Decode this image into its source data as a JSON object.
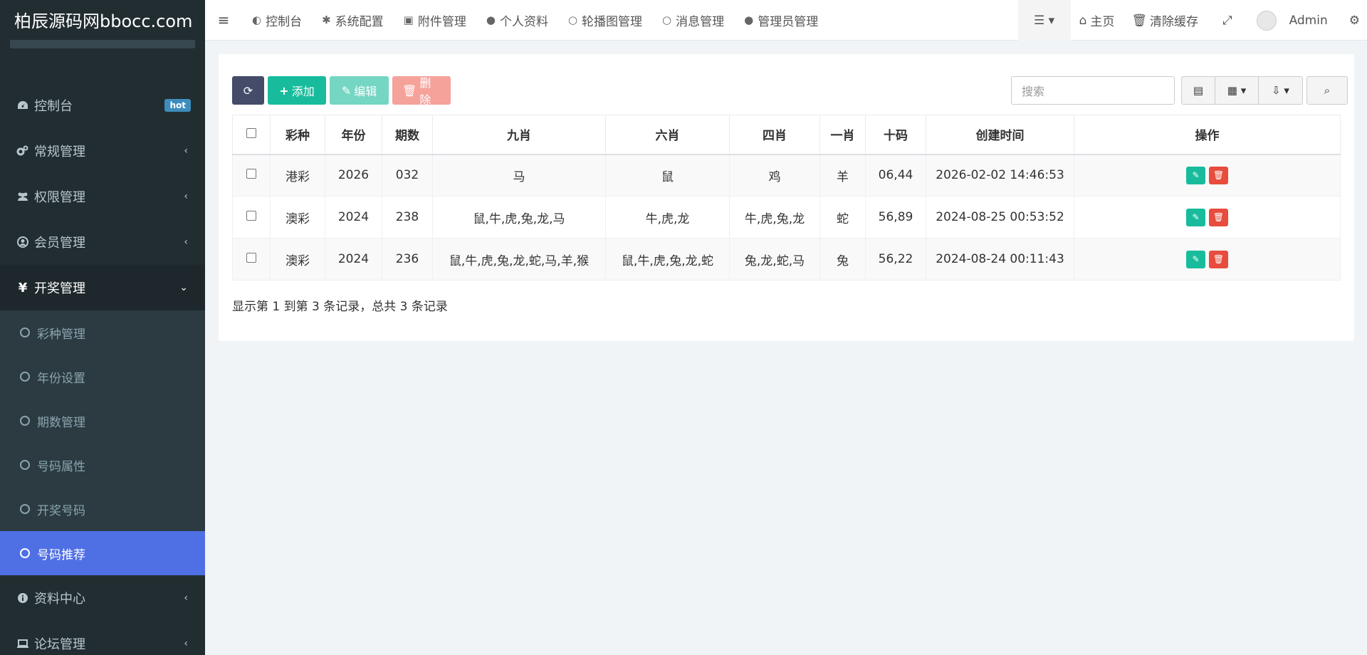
{
  "brand": "柏辰源码网bbocc.com",
  "sidebar": {
    "items": [
      {
        "label": "控制台",
        "icon": "dashboard-icon",
        "badge": "hot"
      },
      {
        "label": "常规管理",
        "icon": "cogs-icon"
      },
      {
        "label": "权限管理",
        "icon": "users-icon"
      },
      {
        "label": "会员管理",
        "icon": "user-circle-icon"
      },
      {
        "label": "开奖管理",
        "icon": "yen-icon"
      }
    ],
    "sub_items": [
      "彩种管理",
      "年份设置",
      "期数管理",
      "号码属性",
      "开奖号码",
      "号码推荐"
    ],
    "bottom_items": [
      {
        "label": "资料中心",
        "icon": "info-icon"
      },
      {
        "label": "论坛管理",
        "icon": "laptop-icon"
      }
    ]
  },
  "topbar": {
    "tabs": [
      {
        "label": "控制台",
        "icon": "dashboard-icon"
      },
      {
        "label": "系统配置",
        "icon": "gear-icon"
      },
      {
        "label": "附件管理",
        "icon": "image-icon"
      },
      {
        "label": "个人资料",
        "icon": "user-icon"
      },
      {
        "label": "轮播图管理",
        "icon": "circle-icon"
      },
      {
        "label": "消息管理",
        "icon": "circle-icon"
      },
      {
        "label": "管理员管理",
        "icon": "user-icon"
      }
    ],
    "home_label": "主页",
    "clear_cache_label": "清除缓存",
    "user_name": "Admin"
  },
  "toolbar": {
    "add_label": "添加",
    "edit_label": "编辑",
    "delete_label": "删除",
    "search_placeholder": "搜索"
  },
  "table": {
    "headers": [
      "彩种",
      "年份",
      "期数",
      "九肖",
      "六肖",
      "四肖",
      "一肖",
      "十码",
      "创建时间",
      "操作"
    ],
    "rows": [
      [
        "港彩",
        "2026",
        "032",
        "马",
        "鼠",
        "鸡",
        "羊",
        "06,44",
        "2026-02-02 14:46:53"
      ],
      [
        "澳彩",
        "2024",
        "238",
        "鼠,牛,虎,兔,龙,马",
        "牛,虎,龙",
        "牛,虎,兔,龙",
        "蛇",
        "56,89",
        "2024-08-25 00:53:52"
      ],
      [
        "澳彩",
        "2024",
        "236",
        "鼠,牛,虎,兔,龙,蛇,马,羊,猴",
        "鼠,牛,虎,兔,龙,蛇",
        "兔,龙,蛇,马",
        "兔",
        "56,22",
        "2024-08-24 00:11:43"
      ]
    ]
  },
  "summary": "显示第 1 到第 3 条记录，总共 3 条记录"
}
